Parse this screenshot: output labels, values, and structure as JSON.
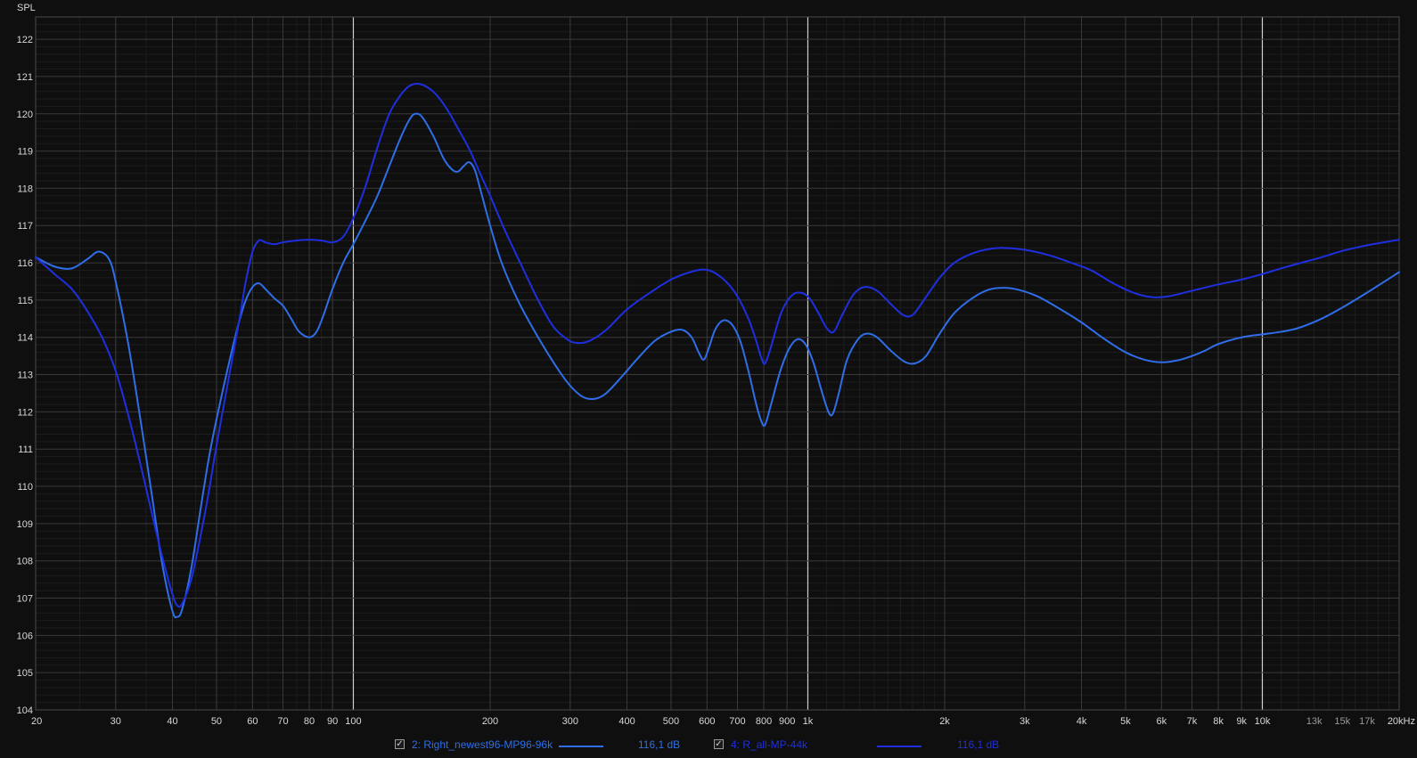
{
  "chart_data": {
    "type": "line",
    "ylabel": "SPL",
    "x_scale": "log",
    "xlim": [
      20,
      20000
    ],
    "ylim": [
      104,
      122.6
    ],
    "y_ticks": [
      104,
      105,
      106,
      107,
      108,
      109,
      110,
      111,
      112,
      113,
      114,
      115,
      116,
      117,
      118,
      119,
      120,
      121,
      122
    ],
    "x_ticks": [
      {
        "v": 20,
        "label": "20"
      },
      {
        "v": 30,
        "label": "30"
      },
      {
        "v": 40,
        "label": "40"
      },
      {
        "v": 50,
        "label": "50"
      },
      {
        "v": 60,
        "label": "60"
      },
      {
        "v": 70,
        "label": "70"
      },
      {
        "v": 80,
        "label": "80"
      },
      {
        "v": 90,
        "label": "90"
      },
      {
        "v": 100,
        "label": "100"
      },
      {
        "v": 200,
        "label": "200"
      },
      {
        "v": 300,
        "label": "300"
      },
      {
        "v": 400,
        "label": "400"
      },
      {
        "v": 500,
        "label": "500"
      },
      {
        "v": 600,
        "label": "600"
      },
      {
        "v": 700,
        "label": "700"
      },
      {
        "v": 800,
        "label": "800"
      },
      {
        "v": 900,
        "label": "900"
      },
      {
        "v": 1000,
        "label": "1k"
      },
      {
        "v": 2000,
        "label": "2k"
      },
      {
        "v": 3000,
        "label": "3k"
      },
      {
        "v": 4000,
        "label": "4k"
      },
      {
        "v": 5000,
        "label": "5k"
      },
      {
        "v": 6000,
        "label": "6k"
      },
      {
        "v": 7000,
        "label": "7k"
      },
      {
        "v": 8000,
        "label": "8k"
      },
      {
        "v": 9000,
        "label": "9k"
      },
      {
        "v": 10000,
        "label": "10k"
      },
      {
        "v": 13000,
        "label": "13k"
      },
      {
        "v": 15000,
        "label": "15k"
      },
      {
        "v": 17000,
        "label": "17k"
      },
      {
        "v": 20000,
        "label": "20kHz"
      }
    ],
    "grid": true,
    "series": [
      {
        "name": "2: Right_newest96-MP96-96k",
        "value_label": "116,1 dB",
        "color": "#2f6ee8",
        "points": [
          [
            20,
            116.15
          ],
          [
            22,
            115.9
          ],
          [
            24,
            115.85
          ],
          [
            26,
            116.1
          ],
          [
            27.5,
            116.3
          ],
          [
            29,
            116.1
          ],
          [
            30,
            115.5
          ],
          [
            32,
            113.8
          ],
          [
            34,
            111.8
          ],
          [
            36,
            109.8
          ],
          [
            38,
            107.9
          ],
          [
            40,
            106.65
          ],
          [
            41,
            106.5
          ],
          [
            42,
            106.7
          ],
          [
            44,
            107.8
          ],
          [
            46,
            109.3
          ],
          [
            48,
            110.7
          ],
          [
            50,
            111.8
          ],
          [
            53,
            113.2
          ],
          [
            56,
            114.4
          ],
          [
            58,
            115.0
          ],
          [
            60,
            115.35
          ],
          [
            62,
            115.45
          ],
          [
            64,
            115.3
          ],
          [
            67,
            115.05
          ],
          [
            70,
            114.85
          ],
          [
            73,
            114.5
          ],
          [
            76,
            114.15
          ],
          [
            80,
            114.0
          ],
          [
            83,
            114.15
          ],
          [
            86,
            114.6
          ],
          [
            90,
            115.3
          ],
          [
            95,
            116.0
          ],
          [
            100,
            116.5
          ],
          [
            106,
            117.1
          ],
          [
            113,
            117.8
          ],
          [
            120,
            118.6
          ],
          [
            127,
            119.35
          ],
          [
            133,
            119.85
          ],
          [
            137,
            120.0
          ],
          [
            142,
            119.9
          ],
          [
            150,
            119.4
          ],
          [
            158,
            118.8
          ],
          [
            165,
            118.5
          ],
          [
            170,
            118.45
          ],
          [
            175,
            118.6
          ],
          [
            180,
            118.7
          ],
          [
            185,
            118.5
          ],
          [
            190,
            118.0
          ],
          [
            200,
            117.0
          ],
          [
            212,
            116.0
          ],
          [
            230,
            115.0
          ],
          [
            255,
            114.0
          ],
          [
            280,
            113.2
          ],
          [
            300,
            112.7
          ],
          [
            320,
            112.4
          ],
          [
            340,
            112.35
          ],
          [
            360,
            112.5
          ],
          [
            390,
            112.95
          ],
          [
            420,
            113.4
          ],
          [
            460,
            113.9
          ],
          [
            500,
            114.15
          ],
          [
            530,
            114.2
          ],
          [
            555,
            114.0
          ],
          [
            575,
            113.6
          ],
          [
            590,
            113.4
          ],
          [
            605,
            113.7
          ],
          [
            625,
            114.2
          ],
          [
            650,
            114.45
          ],
          [
            680,
            114.35
          ],
          [
            710,
            113.9
          ],
          [
            740,
            113.1
          ],
          [
            770,
            112.2
          ],
          [
            790,
            111.75
          ],
          [
            805,
            111.65
          ],
          [
            830,
            112.2
          ],
          [
            870,
            113.1
          ],
          [
            910,
            113.7
          ],
          [
            950,
            113.95
          ],
          [
            990,
            113.8
          ],
          [
            1030,
            113.3
          ],
          [
            1070,
            112.6
          ],
          [
            1110,
            112.0
          ],
          [
            1135,
            111.95
          ],
          [
            1170,
            112.5
          ],
          [
            1220,
            113.4
          ],
          [
            1290,
            113.95
          ],
          [
            1350,
            114.1
          ],
          [
            1420,
            114.0
          ],
          [
            1520,
            113.65
          ],
          [
            1630,
            113.35
          ],
          [
            1720,
            113.3
          ],
          [
            1820,
            113.5
          ],
          [
            1950,
            114.1
          ],
          [
            2100,
            114.65
          ],
          [
            2300,
            115.05
          ],
          [
            2500,
            115.28
          ],
          [
            2700,
            115.33
          ],
          [
            2900,
            115.28
          ],
          [
            3200,
            115.1
          ],
          [
            3600,
            114.75
          ],
          [
            4000,
            114.4
          ],
          [
            4500,
            113.95
          ],
          [
            5000,
            113.6
          ],
          [
            5500,
            113.4
          ],
          [
            6000,
            113.33
          ],
          [
            6500,
            113.38
          ],
          [
            7000,
            113.5
          ],
          [
            7500,
            113.65
          ],
          [
            8000,
            113.82
          ],
          [
            9000,
            114.0
          ],
          [
            10000,
            114.08
          ],
          [
            11000,
            114.15
          ],
          [
            12000,
            114.25
          ],
          [
            13500,
            114.5
          ],
          [
            15000,
            114.8
          ],
          [
            17000,
            115.2
          ],
          [
            20000,
            115.75
          ]
        ]
      },
      {
        "name": "4: R_all-MP-44k",
        "value_label": "116,1 dB",
        "color": "#1f2fe0",
        "points": [
          [
            20,
            116.15
          ],
          [
            22,
            115.7
          ],
          [
            24,
            115.3
          ],
          [
            26,
            114.7
          ],
          [
            28,
            114.0
          ],
          [
            30,
            113.1
          ],
          [
            32,
            111.9
          ],
          [
            34,
            110.6
          ],
          [
            36,
            109.3
          ],
          [
            38,
            108.1
          ],
          [
            40,
            107.1
          ],
          [
            41,
            106.8
          ],
          [
            42,
            106.85
          ],
          [
            44,
            107.5
          ],
          [
            46,
            108.6
          ],
          [
            48,
            109.8
          ],
          [
            50,
            111.1
          ],
          [
            53,
            112.8
          ],
          [
            56,
            114.4
          ],
          [
            58,
            115.5
          ],
          [
            60,
            116.3
          ],
          [
            62,
            116.6
          ],
          [
            64,
            116.55
          ],
          [
            67,
            116.5
          ],
          [
            70,
            116.55
          ],
          [
            75,
            116.6
          ],
          [
            80,
            116.62
          ],
          [
            85,
            116.6
          ],
          [
            90,
            116.55
          ],
          [
            95,
            116.7
          ],
          [
            100,
            117.2
          ],
          [
            106,
            118.0
          ],
          [
            113,
            119.1
          ],
          [
            120,
            120.0
          ],
          [
            127,
            120.5
          ],
          [
            133,
            120.75
          ],
          [
            140,
            120.8
          ],
          [
            148,
            120.65
          ],
          [
            155,
            120.4
          ],
          [
            163,
            120.0
          ],
          [
            170,
            119.6
          ],
          [
            180,
            119.05
          ],
          [
            190,
            118.4
          ],
          [
            200,
            117.8
          ],
          [
            215,
            116.9
          ],
          [
            235,
            115.9
          ],
          [
            255,
            115.0
          ],
          [
            275,
            114.3
          ],
          [
            295,
            113.95
          ],
          [
            310,
            113.85
          ],
          [
            330,
            113.9
          ],
          [
            360,
            114.2
          ],
          [
            400,
            114.75
          ],
          [
            450,
            115.2
          ],
          [
            500,
            115.55
          ],
          [
            550,
            115.75
          ],
          [
            590,
            115.82
          ],
          [
            620,
            115.75
          ],
          [
            660,
            115.5
          ],
          [
            700,
            115.1
          ],
          [
            740,
            114.5
          ],
          [
            770,
            113.9
          ],
          [
            790,
            113.45
          ],
          [
            805,
            113.3
          ],
          [
            830,
            113.75
          ],
          [
            870,
            114.6
          ],
          [
            910,
            115.05
          ],
          [
            950,
            115.2
          ],
          [
            1000,
            115.1
          ],
          [
            1050,
            114.7
          ],
          [
            1100,
            114.25
          ],
          [
            1140,
            114.15
          ],
          [
            1190,
            114.6
          ],
          [
            1260,
            115.15
          ],
          [
            1330,
            115.35
          ],
          [
            1420,
            115.25
          ],
          [
            1520,
            114.9
          ],
          [
            1620,
            114.6
          ],
          [
            1700,
            114.6
          ],
          [
            1800,
            115.0
          ],
          [
            1950,
            115.6
          ],
          [
            2100,
            116.0
          ],
          [
            2300,
            116.25
          ],
          [
            2500,
            116.37
          ],
          [
            2700,
            116.4
          ],
          [
            3000,
            116.35
          ],
          [
            3400,
            116.2
          ],
          [
            3800,
            116.0
          ],
          [
            4200,
            115.8
          ],
          [
            4700,
            115.45
          ],
          [
            5200,
            115.2
          ],
          [
            5700,
            115.08
          ],
          [
            6200,
            115.1
          ],
          [
            7000,
            115.25
          ],
          [
            8000,
            115.42
          ],
          [
            9000,
            115.55
          ],
          [
            10000,
            115.7
          ],
          [
            11000,
            115.85
          ],
          [
            12000,
            115.98
          ],
          [
            13500,
            116.15
          ],
          [
            15000,
            116.32
          ],
          [
            17000,
            116.47
          ],
          [
            20000,
            116.62
          ]
        ]
      }
    ]
  },
  "legend": [
    {
      "checkbox": "✓",
      "name": "2: Right_newest96-MP96-96k",
      "value": "116,1 dB",
      "color": "#2f6ee8"
    },
    {
      "checkbox": "✓",
      "name": "4: R_all-MP-44k",
      "value": "116,1 dB",
      "color": "#1f2fe0"
    }
  ]
}
